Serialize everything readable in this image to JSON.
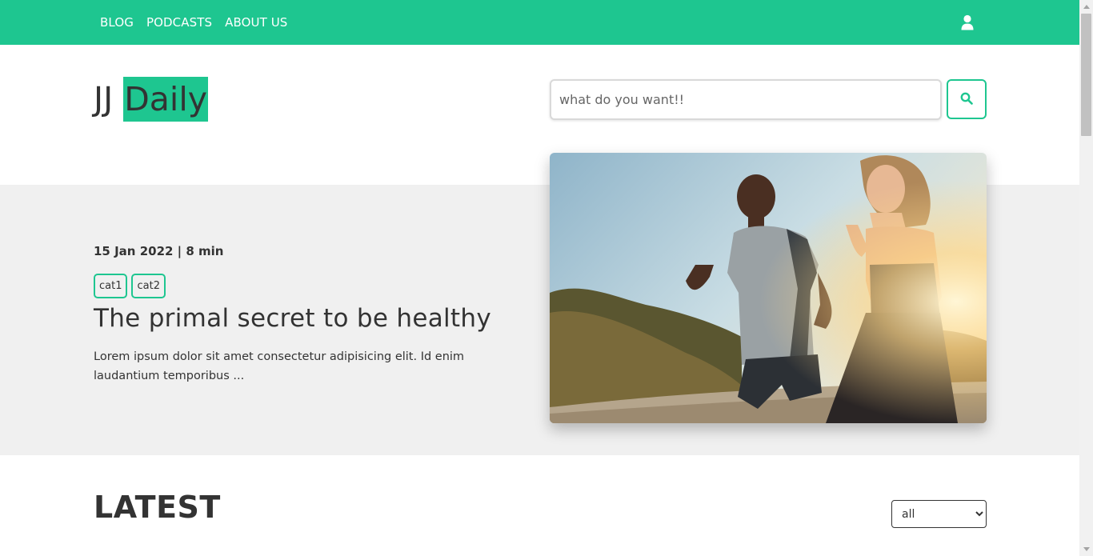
{
  "nav": {
    "links": [
      {
        "label": "BLOG"
      },
      {
        "label": "PODCASTS"
      },
      {
        "label": "ABOUT US"
      }
    ],
    "user_icon": "user-icon"
  },
  "header": {
    "logo_part1": "JJ",
    "logo_part2": "Daily",
    "search_placeholder": "what do you want!!",
    "search_icon": "search-icon"
  },
  "featured": {
    "meta": "15 Jan 2022 | 8 min",
    "tags": [
      "cat1",
      "cat2"
    ],
    "title": "The primal secret to be healthy",
    "excerpt": "Lorem ipsum dolor sit amet consectetur adipisicing elit. Id enim laudantium temporibus ..."
  },
  "latest": {
    "title": "LATEST",
    "filter_selected": "all"
  },
  "colors": {
    "accent": "#1ec690",
    "band": "#f0f0f0",
    "text": "#333333"
  }
}
